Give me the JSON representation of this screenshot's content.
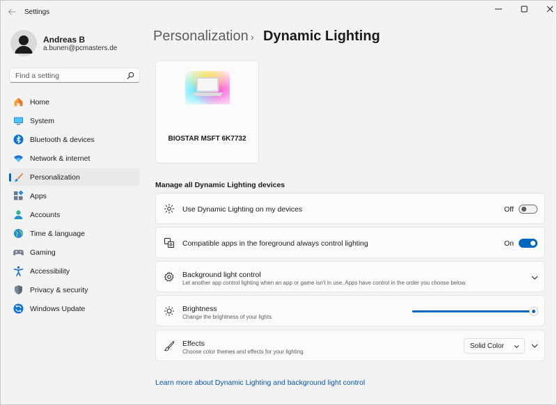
{
  "window": {
    "title": "Settings"
  },
  "user": {
    "name": "Andreas B",
    "email": "a.bunen@pcmasters.de"
  },
  "search": {
    "placeholder": "Find a setting"
  },
  "nav": {
    "items": [
      {
        "label": "Home",
        "icon": "home-icon"
      },
      {
        "label": "System",
        "icon": "system-icon"
      },
      {
        "label": "Bluetooth & devices",
        "icon": "bluetooth-icon"
      },
      {
        "label": "Network & internet",
        "icon": "wifi-icon"
      },
      {
        "label": "Personalization",
        "icon": "brush-icon",
        "active": true
      },
      {
        "label": "Apps",
        "icon": "apps-icon"
      },
      {
        "label": "Accounts",
        "icon": "accounts-icon"
      },
      {
        "label": "Time & language",
        "icon": "globe-icon"
      },
      {
        "label": "Gaming",
        "icon": "gamepad-icon"
      },
      {
        "label": "Accessibility",
        "icon": "accessibility-icon"
      },
      {
        "label": "Privacy & security",
        "icon": "shield-icon"
      },
      {
        "label": "Windows Update",
        "icon": "update-icon"
      }
    ]
  },
  "breadcrumb": {
    "parent": "Personalization",
    "separator": "›",
    "current": "Dynamic Lighting"
  },
  "device": {
    "name": "BIOSTAR MSFT 6K7732"
  },
  "section": {
    "title": "Manage all Dynamic Lighting devices"
  },
  "settings": {
    "use_dynamic": {
      "title": "Use Dynamic Lighting on my devices",
      "state": "Off",
      "enabled": false
    },
    "foreground_apps": {
      "title": "Compatible apps in the foreground always control lighting",
      "state": "On",
      "enabled": true
    },
    "background_control": {
      "title": "Background light control",
      "subtitle": "Let another app control lighting when an app or game isn't in use. Apps have control in the order you choose below."
    },
    "brightness": {
      "title": "Brightness",
      "subtitle": "Change the brightness of your lights",
      "value": 100
    },
    "effects": {
      "title": "Effects",
      "subtitle": "Choose color themes and effects for your lighting",
      "selected": "Solid Color"
    }
  },
  "learn_more": "Learn more about Dynamic Lighting and background light control",
  "colors": {
    "accent": "#0067c0",
    "background": "#f3f3f3",
    "card": "#fbfbfb"
  }
}
